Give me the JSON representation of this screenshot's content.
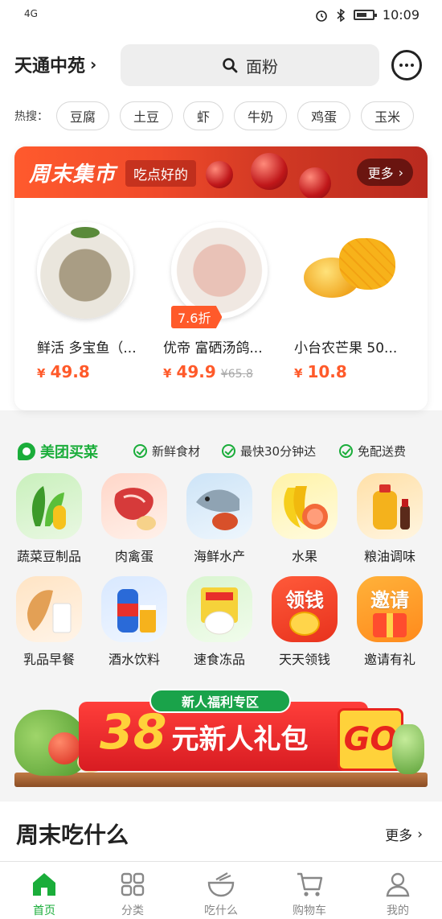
{
  "status": {
    "network": "4G",
    "time": "10:09"
  },
  "header": {
    "location": "天通中苑",
    "search_placeholder": "面粉"
  },
  "hot_search": {
    "label": "热搜：",
    "items": [
      "豆腐",
      "土豆",
      "虾",
      "牛奶",
      "鸡蛋",
      "玉米"
    ]
  },
  "market": {
    "title": "周末集市",
    "subtitle": "吃点好的",
    "more": "更多",
    "products": [
      {
        "name": "鲜活 多宝鱼（...",
        "price": "49.8",
        "original_price": "",
        "discount": ""
      },
      {
        "name": "优帝 富硒汤鸽...",
        "price": "49.9",
        "original_price": "¥65.8",
        "discount": "7.6折"
      },
      {
        "name": "小台农芒果 50...",
        "price": "10.8",
        "original_price": "",
        "discount": ""
      }
    ]
  },
  "brand": {
    "name": "美团买菜",
    "features": [
      "新鲜食材",
      "最快30分钟达",
      "免配送费"
    ]
  },
  "categories": [
    {
      "label": "蔬菜豆制品",
      "icon": "vegetables-icon"
    },
    {
      "label": "肉禽蛋",
      "icon": "meat-icon"
    },
    {
      "label": "海鲜水产",
      "icon": "seafood-icon"
    },
    {
      "label": "水果",
      "icon": "fruit-icon"
    },
    {
      "label": "粮油调味",
      "icon": "grain-oil-icon"
    },
    {
      "label": "乳品早餐",
      "icon": "dairy-icon"
    },
    {
      "label": "酒水饮料",
      "icon": "drinks-icon"
    },
    {
      "label": "速食冻品",
      "icon": "frozen-food-icon"
    },
    {
      "label": "天天领钱",
      "icon": "money-icon",
      "badge": "领钱"
    },
    {
      "label": "邀请有礼",
      "icon": "gift-icon",
      "badge": "邀请"
    }
  ],
  "banner": {
    "tag": "新人福利专区",
    "amount": "38",
    "text": "元新人礼包",
    "go": "GO"
  },
  "weekend": {
    "title": "周末吃什么",
    "more": "更多"
  },
  "tabs": [
    {
      "label": "首页",
      "icon": "home-icon",
      "active": true
    },
    {
      "label": "分类",
      "icon": "category-icon",
      "active": false
    },
    {
      "label": "吃什么",
      "icon": "bowl-icon",
      "active": false
    },
    {
      "label": "购物车",
      "icon": "cart-icon",
      "active": false
    },
    {
      "label": "我的",
      "icon": "profile-icon",
      "active": false
    }
  ],
  "colors": {
    "brand_green": "#1aad3a",
    "price_orange": "#ff5a2a",
    "banner_red": "#e8251d"
  }
}
